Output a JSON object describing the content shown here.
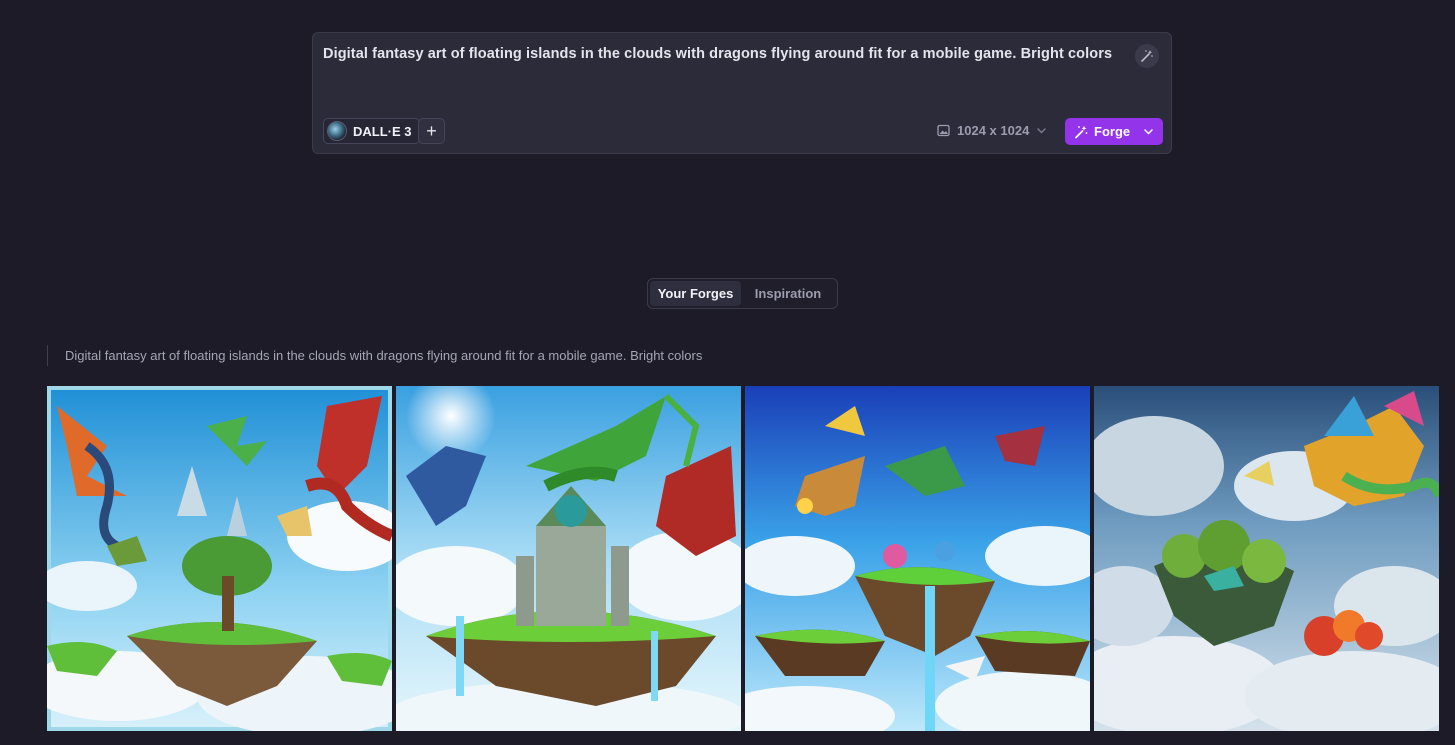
{
  "prompt": {
    "text": "Digital fantasy art of floating islands in the clouds with dragons flying around fit for a mobile game. Bright colors",
    "model_label": "DALL·E 3",
    "add_symbol": "+",
    "size_label": "1024 x 1024",
    "forge_label": "Forge"
  },
  "tabs": [
    {
      "label": "Your Forges",
      "active": true
    },
    {
      "label": "Inspiration",
      "active": false
    }
  ],
  "history": {
    "prompt_text": "Digital fantasy art of floating islands in the clouds with dragons flying around fit for a mobile game. Bright colors"
  },
  "images": [
    {
      "name": "generated-image-1"
    },
    {
      "name": "generated-image-2"
    },
    {
      "name": "generated-image-3"
    },
    {
      "name": "generated-image-4"
    }
  ],
  "colors": {
    "accent": "#9333ea",
    "background": "#1c1b27",
    "panel": "#2b2b3a"
  }
}
